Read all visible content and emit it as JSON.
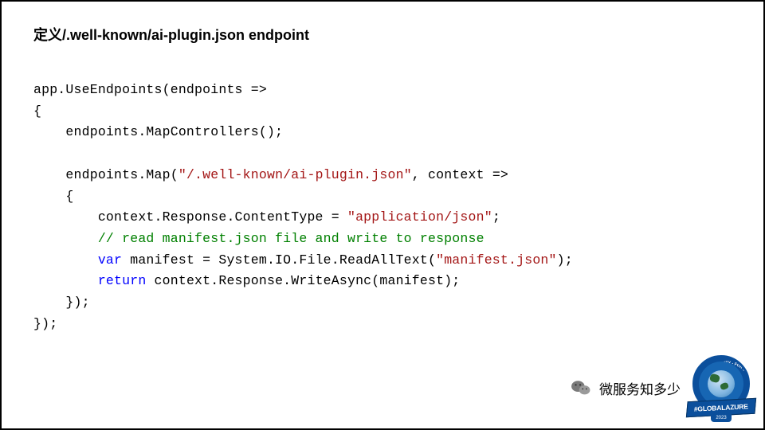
{
  "title": "定义/.well-known/ai-plugin.json  endpoint",
  "code": {
    "l1a": "app.UseEndpoints(endpoints =>",
    "l2": "{",
    "l3": "    endpoints.MapControllers();",
    "l4": "",
    "l5a": "    endpoints.Map(",
    "l5s": "\"/.well-known/ai-plugin.json\"",
    "l5b": ", context =>",
    "l6": "    {",
    "l7a": "        context.Response.ContentType = ",
    "l7s": "\"application/json\"",
    "l7b": ";",
    "l8c": "        // read manifest.json file and write to response",
    "l9k": "        var",
    "l9a": " manifest = System.IO.File.ReadAllText(",
    "l9s": "\"manifest.json\"",
    "l9b": ");",
    "l10k": "        return",
    "l10a": " context.Response.WriteAsync(manifest);",
    "l11": "    });",
    "l12": "});"
  },
  "footer": {
    "account": "微服务知多少",
    "badge_banner": "#GLOBALAZURE",
    "badge_year": "2023",
    "badge_ring": "BY COMMUNITY - FOR COMMUNITY"
  }
}
